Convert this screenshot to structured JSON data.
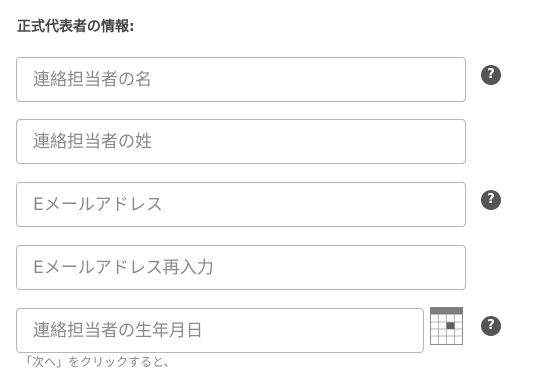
{
  "section": {
    "title": "正式代表者の情報:"
  },
  "fields": {
    "first_name": {
      "placeholder": "連絡担当者の名"
    },
    "last_name": {
      "placeholder": "連絡担当者の姓"
    },
    "email": {
      "placeholder": "Eメールアドレス"
    },
    "email_confirm": {
      "placeholder": "Eメールアドレス再入力"
    },
    "birthdate": {
      "placeholder": "連絡担当者の生年月日"
    }
  },
  "icons": {
    "help": "?",
    "help_icon_name": "question-circle-icon",
    "calendar_icon_name": "calendar-icon"
  },
  "hint": {
    "text": "「次へ」をクリックすると、"
  },
  "colors": {
    "border": "#b7b7b7",
    "placeholder": "#8a8a8a",
    "help_icon": "#545454",
    "title": "#444444"
  }
}
